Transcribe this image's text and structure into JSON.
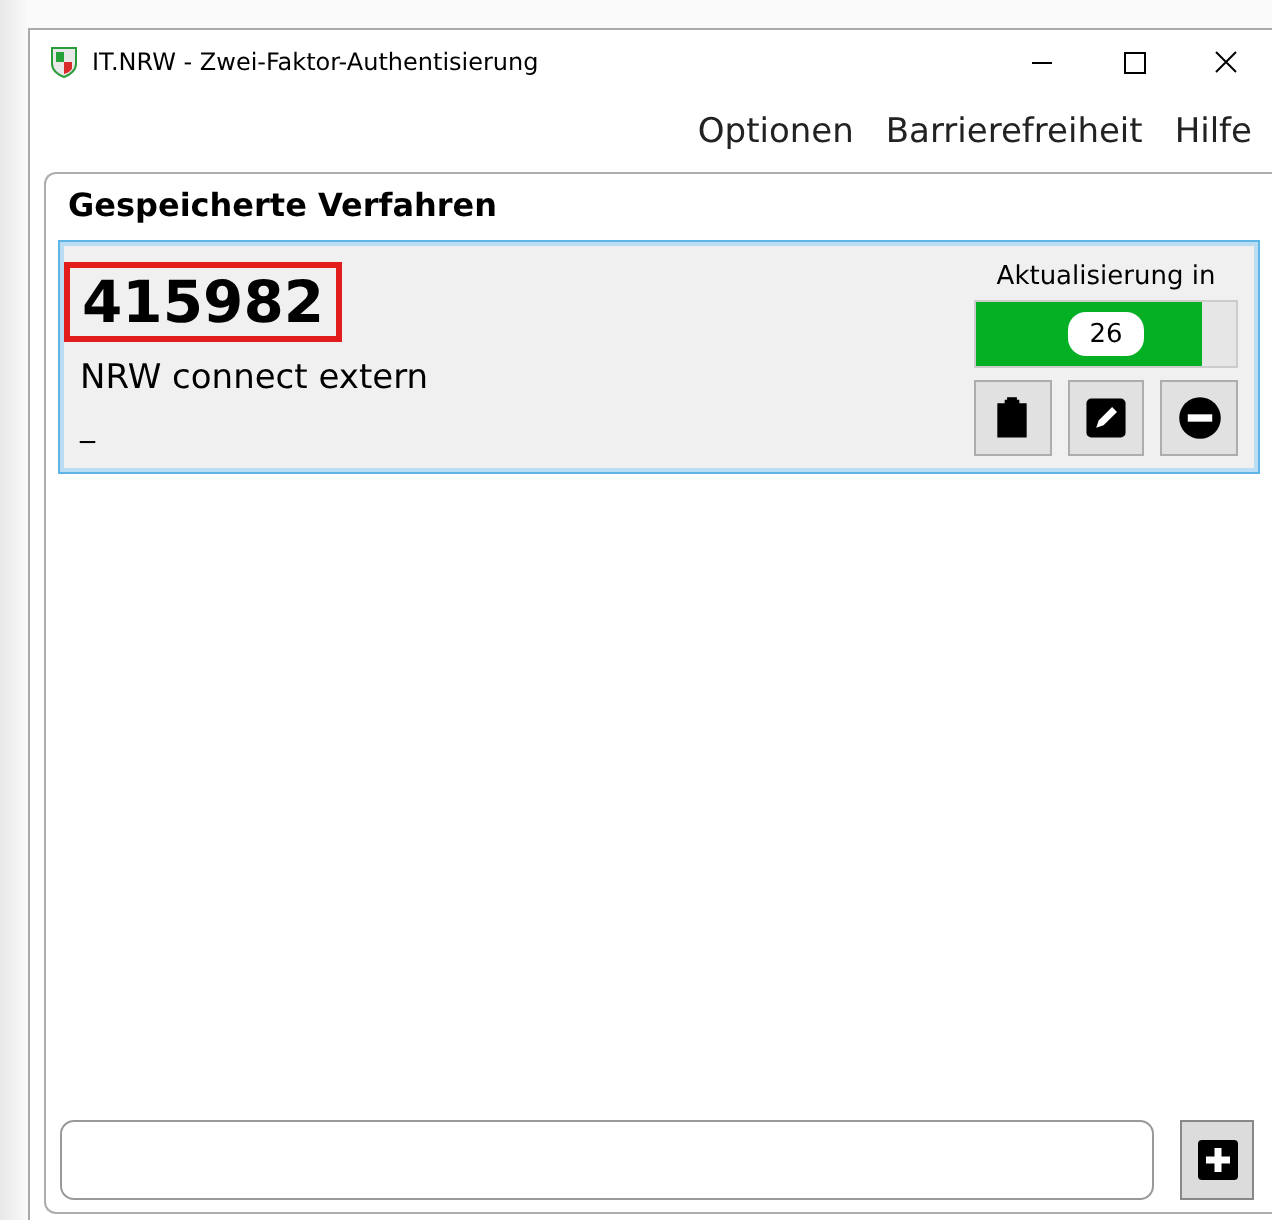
{
  "window": {
    "title": "IT.NRW - Zwei-Faktor-Authentisierung"
  },
  "menu": [
    {
      "label": "Optionen"
    },
    {
      "label": "Barrierefreiheit"
    },
    {
      "label": "Hilfe"
    }
  ],
  "panel": {
    "title": "Gespeicherte Verfahren"
  },
  "entries": [
    {
      "code": "415982",
      "highlighted": true,
      "name": "NRW connect extern",
      "note": "_",
      "refresh_label": "Aktualisierung in",
      "countdown": "26",
      "level": 0.87,
      "selected": true
    }
  ]
}
